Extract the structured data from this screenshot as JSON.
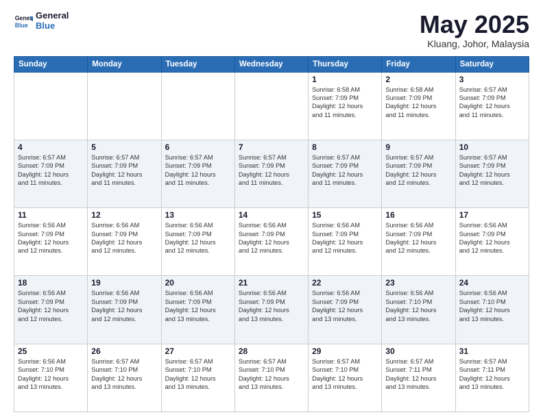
{
  "logo": {
    "line1": "General",
    "line2": "Blue"
  },
  "title": "May 2025",
  "subtitle": "Kluang, Johor, Malaysia",
  "weekdays": [
    "Sunday",
    "Monday",
    "Tuesday",
    "Wednesday",
    "Thursday",
    "Friday",
    "Saturday"
  ],
  "weeks": [
    [
      {
        "day": "",
        "info": ""
      },
      {
        "day": "",
        "info": ""
      },
      {
        "day": "",
        "info": ""
      },
      {
        "day": "",
        "info": ""
      },
      {
        "day": "1",
        "info": "Sunrise: 6:58 AM\nSunset: 7:09 PM\nDaylight: 12 hours\nand 11 minutes."
      },
      {
        "day": "2",
        "info": "Sunrise: 6:58 AM\nSunset: 7:09 PM\nDaylight: 12 hours\nand 11 minutes."
      },
      {
        "day": "3",
        "info": "Sunrise: 6:57 AM\nSunset: 7:09 PM\nDaylight: 12 hours\nand 11 minutes."
      }
    ],
    [
      {
        "day": "4",
        "info": "Sunrise: 6:57 AM\nSunset: 7:09 PM\nDaylight: 12 hours\nand 11 minutes."
      },
      {
        "day": "5",
        "info": "Sunrise: 6:57 AM\nSunset: 7:09 PM\nDaylight: 12 hours\nand 11 minutes."
      },
      {
        "day": "6",
        "info": "Sunrise: 6:57 AM\nSunset: 7:09 PM\nDaylight: 12 hours\nand 11 minutes."
      },
      {
        "day": "7",
        "info": "Sunrise: 6:57 AM\nSunset: 7:09 PM\nDaylight: 12 hours\nand 11 minutes."
      },
      {
        "day": "8",
        "info": "Sunrise: 6:57 AM\nSunset: 7:09 PM\nDaylight: 12 hours\nand 11 minutes."
      },
      {
        "day": "9",
        "info": "Sunrise: 6:57 AM\nSunset: 7:09 PM\nDaylight: 12 hours\nand 12 minutes."
      },
      {
        "day": "10",
        "info": "Sunrise: 6:57 AM\nSunset: 7:09 PM\nDaylight: 12 hours\nand 12 minutes."
      }
    ],
    [
      {
        "day": "11",
        "info": "Sunrise: 6:56 AM\nSunset: 7:09 PM\nDaylight: 12 hours\nand 12 minutes."
      },
      {
        "day": "12",
        "info": "Sunrise: 6:56 AM\nSunset: 7:09 PM\nDaylight: 12 hours\nand 12 minutes."
      },
      {
        "day": "13",
        "info": "Sunrise: 6:56 AM\nSunset: 7:09 PM\nDaylight: 12 hours\nand 12 minutes."
      },
      {
        "day": "14",
        "info": "Sunrise: 6:56 AM\nSunset: 7:09 PM\nDaylight: 12 hours\nand 12 minutes."
      },
      {
        "day": "15",
        "info": "Sunrise: 6:56 AM\nSunset: 7:09 PM\nDaylight: 12 hours\nand 12 minutes."
      },
      {
        "day": "16",
        "info": "Sunrise: 6:56 AM\nSunset: 7:09 PM\nDaylight: 12 hours\nand 12 minutes."
      },
      {
        "day": "17",
        "info": "Sunrise: 6:56 AM\nSunset: 7:09 PM\nDaylight: 12 hours\nand 12 minutes."
      }
    ],
    [
      {
        "day": "18",
        "info": "Sunrise: 6:56 AM\nSunset: 7:09 PM\nDaylight: 12 hours\nand 12 minutes."
      },
      {
        "day": "19",
        "info": "Sunrise: 6:56 AM\nSunset: 7:09 PM\nDaylight: 12 hours\nand 12 minutes."
      },
      {
        "day": "20",
        "info": "Sunrise: 6:56 AM\nSunset: 7:09 PM\nDaylight: 12 hours\nand 13 minutes."
      },
      {
        "day": "21",
        "info": "Sunrise: 6:56 AM\nSunset: 7:09 PM\nDaylight: 12 hours\nand 13 minutes."
      },
      {
        "day": "22",
        "info": "Sunrise: 6:56 AM\nSunset: 7:09 PM\nDaylight: 12 hours\nand 13 minutes."
      },
      {
        "day": "23",
        "info": "Sunrise: 6:56 AM\nSunset: 7:10 PM\nDaylight: 12 hours\nand 13 minutes."
      },
      {
        "day": "24",
        "info": "Sunrise: 6:56 AM\nSunset: 7:10 PM\nDaylight: 12 hours\nand 13 minutes."
      }
    ],
    [
      {
        "day": "25",
        "info": "Sunrise: 6:56 AM\nSunset: 7:10 PM\nDaylight: 12 hours\nand 13 minutes."
      },
      {
        "day": "26",
        "info": "Sunrise: 6:57 AM\nSunset: 7:10 PM\nDaylight: 12 hours\nand 13 minutes."
      },
      {
        "day": "27",
        "info": "Sunrise: 6:57 AM\nSunset: 7:10 PM\nDaylight: 12 hours\nand 13 minutes."
      },
      {
        "day": "28",
        "info": "Sunrise: 6:57 AM\nSunset: 7:10 PM\nDaylight: 12 hours\nand 13 minutes."
      },
      {
        "day": "29",
        "info": "Sunrise: 6:57 AM\nSunset: 7:10 PM\nDaylight: 12 hours\nand 13 minutes."
      },
      {
        "day": "30",
        "info": "Sunrise: 6:57 AM\nSunset: 7:11 PM\nDaylight: 12 hours\nand 13 minutes."
      },
      {
        "day": "31",
        "info": "Sunrise: 6:57 AM\nSunset: 7:11 PM\nDaylight: 12 hours\nand 13 minutes."
      }
    ]
  ]
}
